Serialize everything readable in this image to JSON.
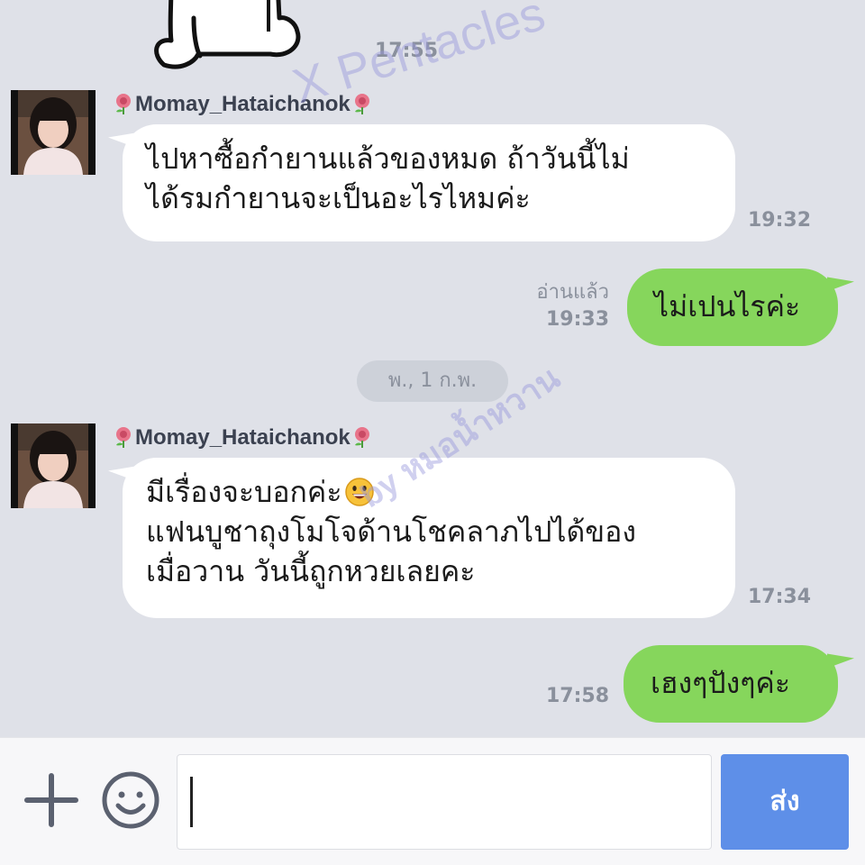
{
  "messages": [
    {
      "time": "17:55"
    },
    {
      "sender": "Momay_Hataichanok",
      "lines": [
        "ไปหาซื้อกำยานแล้วของหมด ถ้าวันนี้ไม่",
        "ได้รมกำยานจะเป็นอะไรไหมค่ะ"
      ],
      "time": "19:32"
    },
    {
      "read": "อ่านแล้ว",
      "text": "ไม่เปนไรค่ะ",
      "time": "19:33"
    },
    {
      "date": "พ., 1 ก.พ."
    },
    {
      "sender": "Momay_Hataichanok",
      "lines": [
        "มีเรื่องจะบอกค่ะ",
        "แฟนบูชาถุงโมโจด้านโชคลาภไปได้ของ",
        "เมื่อวาน วันนี้ถูกหวยเลยคะ"
      ],
      "time": "17:34"
    },
    {
      "text": "เฮงๆปังๆค่ะ",
      "time": "17:58"
    }
  ],
  "watermarks": [
    "X Pentacles",
    "by หมอน้ำหวาน"
  ],
  "input": {
    "placeholder": "",
    "send_label": "ส่ง"
  },
  "icons": {
    "plus": "plus-icon",
    "emoji": "smiley-icon",
    "rose": "rose-emoji",
    "grin": "grinning-emoji"
  },
  "colors": {
    "background": "#dfe1e8",
    "outgoing_bubble": "#86d65c",
    "incoming_bubble": "#ffffff",
    "send_button": "#5e8fe8"
  }
}
